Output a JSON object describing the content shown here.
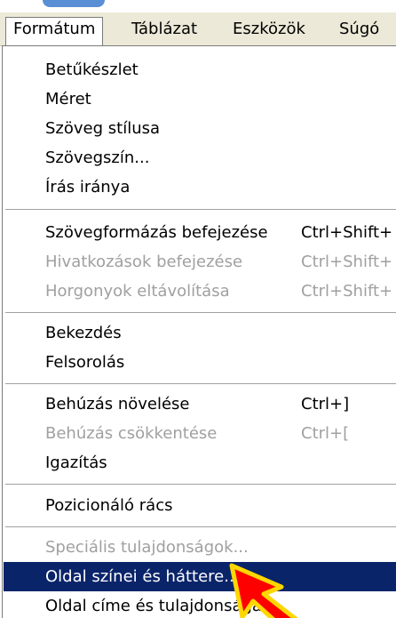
{
  "menubar": {
    "items": [
      {
        "label": "Formátum",
        "open": true
      },
      {
        "label": "Táblázat"
      },
      {
        "label": "Eszközök"
      },
      {
        "label": "Súgó"
      }
    ]
  },
  "dropdown": {
    "items": [
      {
        "label": "Betűkészlet"
      },
      {
        "label": "Méret"
      },
      {
        "label": "Szöveg stílusa"
      },
      {
        "label": "Szövegszín..."
      },
      {
        "label": "Írás iránya"
      },
      {
        "label": "Szövegformázás befejezése",
        "shortcut": "Ctrl+Shift+"
      },
      {
        "label": "Hivatkozások befejezése",
        "shortcut": "Ctrl+Shift+",
        "disabled": true
      },
      {
        "label": "Horgonyok eltávolítása",
        "shortcut": "Ctrl+Shift+",
        "disabled": true
      },
      {
        "label": "Bekezdés"
      },
      {
        "label": "Felsorolás"
      },
      {
        "label": "Behúzás növelése",
        "shortcut": "Ctrl+]"
      },
      {
        "label": "Behúzás csökkentése",
        "shortcut": "Ctrl+[",
        "disabled": true
      },
      {
        "label": "Igazítás"
      },
      {
        "label": "Pozicionáló rács"
      },
      {
        "label": "Speciális tulajdonságok...",
        "disabled": true
      },
      {
        "label": "Oldal színei és háttere...",
        "highlighted": true
      },
      {
        "label": "Oldal címe és tulajdonságai..."
      }
    ]
  },
  "colors": {
    "menubar_bg": "#ece9d8",
    "highlight_bg": "#0a246a",
    "disabled_text": "#a0a0a0",
    "cursor_fill": "#ff0000",
    "cursor_outline": "#ffd700"
  },
  "icons": {
    "cursor": "mouse-pointer-arrow-icon"
  }
}
